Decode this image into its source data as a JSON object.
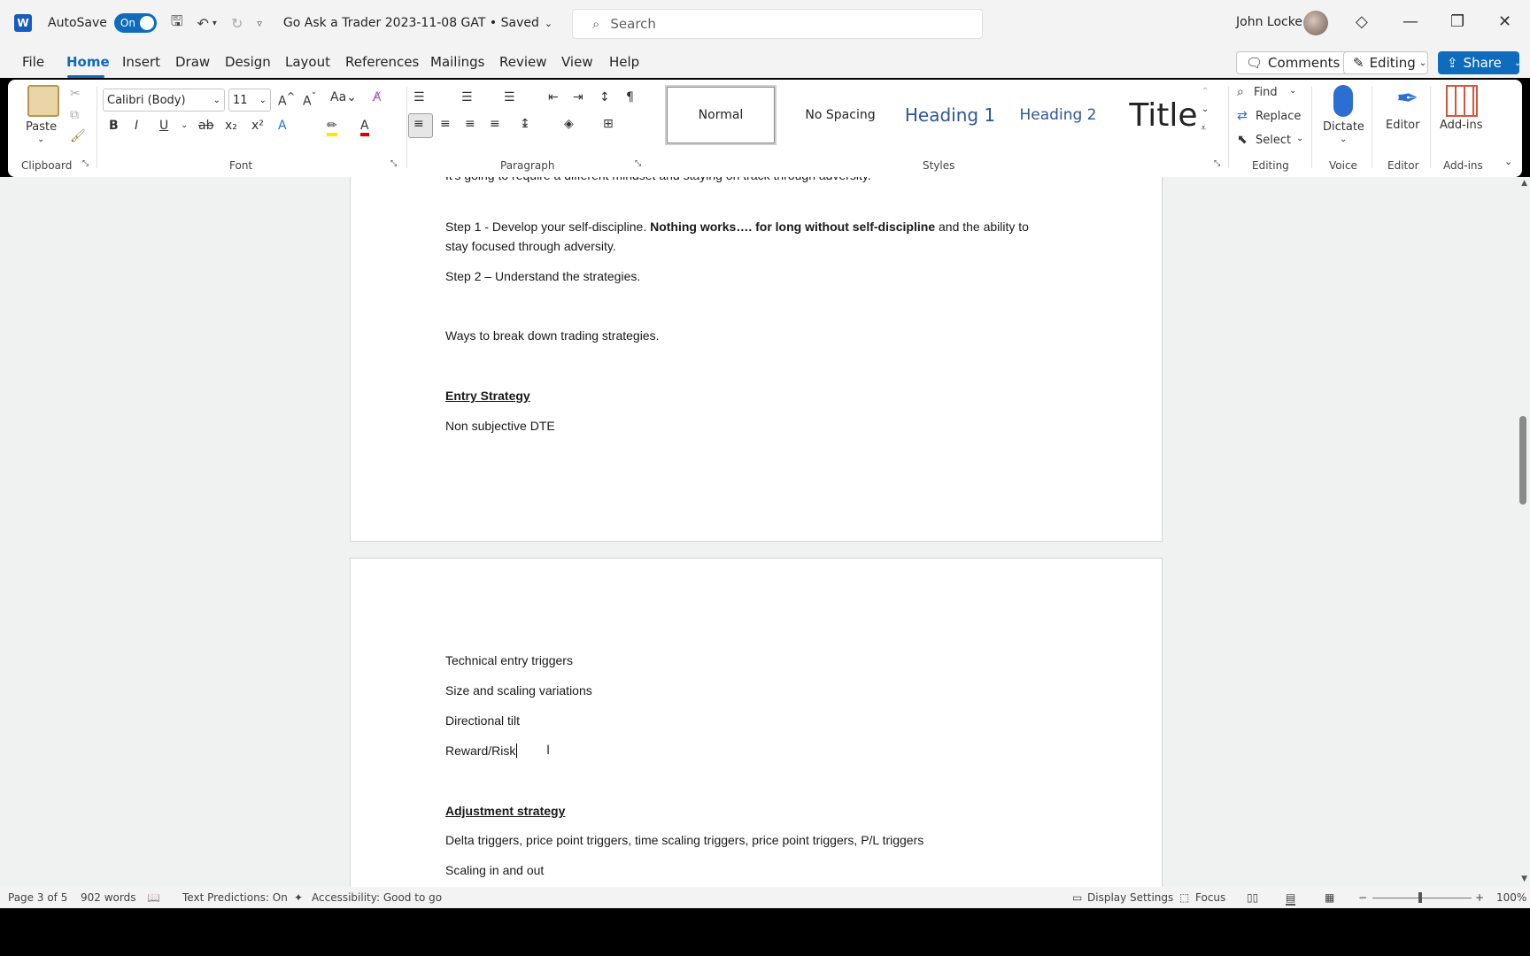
{
  "titlebar": {
    "autosave_label": "AutoSave",
    "autosave_state": "On",
    "doc_title": "Go Ask a Trader 2023-11-08 GAT • Saved",
    "search_placeholder": "Search",
    "user_name": "John Locke"
  },
  "menu": {
    "file": "File",
    "home": "Home",
    "insert": "Insert",
    "draw": "Draw",
    "design": "Design",
    "layout": "Layout",
    "references": "References",
    "mailings": "Mailings",
    "review": "Review",
    "view": "View",
    "help": "Help",
    "comments": "Comments",
    "editing": "Editing",
    "share": "Share"
  },
  "ribbon": {
    "paste": "Paste",
    "font_name": "Calibri (Body)",
    "font_size": "11",
    "groups": {
      "clipboard": "Clipboard",
      "font": "Font",
      "paragraph": "Paragraph",
      "styles": "Styles",
      "editing": "Editing",
      "voice": "Voice",
      "editor": "Editor",
      "addins": "Add-ins"
    },
    "styles": {
      "normal": "Normal",
      "no_spacing": "No Spacing",
      "heading1": "Heading 1",
      "heading2": "Heading 2",
      "title": "Title"
    },
    "find": "Find",
    "replace": "Replace",
    "select": "Select",
    "dictate": "Dictate",
    "editor": "Editor",
    "addins": "Add-ins"
  },
  "document": {
    "cut_line": "It's going to require a different mindset and staying on track through adversity.",
    "step1_a": "Step 1 - Develop your self-discipline. ",
    "step1_bold": "Nothing works…. for long without self-discipline",
    "step1_b": " and the ability to",
    "step1_c": "stay focused through adversity.",
    "step2": "Step 2 – Understand the strategies.",
    "ways": "Ways to break down trading strategies.",
    "entry_heading": "Entry Strategy",
    "non_subjective": "Non subjective DTE",
    "technical": "Technical entry triggers",
    "size": "Size and scaling variations",
    "directional": "Directional tilt",
    "reward": " Reward/Risk ",
    "adjustment_heading": "Adjustment strategy",
    "delta": "Delta triggers, price point triggers, time scaling triggers, price point triggers, P/L triggers",
    "scaling": "Scaling in and out"
  },
  "status": {
    "page": "Page 3 of 5",
    "words": "902 words",
    "text_predictions": "Text Predictions: On",
    "accessibility": "Accessibility: Good to go",
    "display_settings": "Display Settings",
    "focus": "Focus",
    "zoom": "100%"
  }
}
